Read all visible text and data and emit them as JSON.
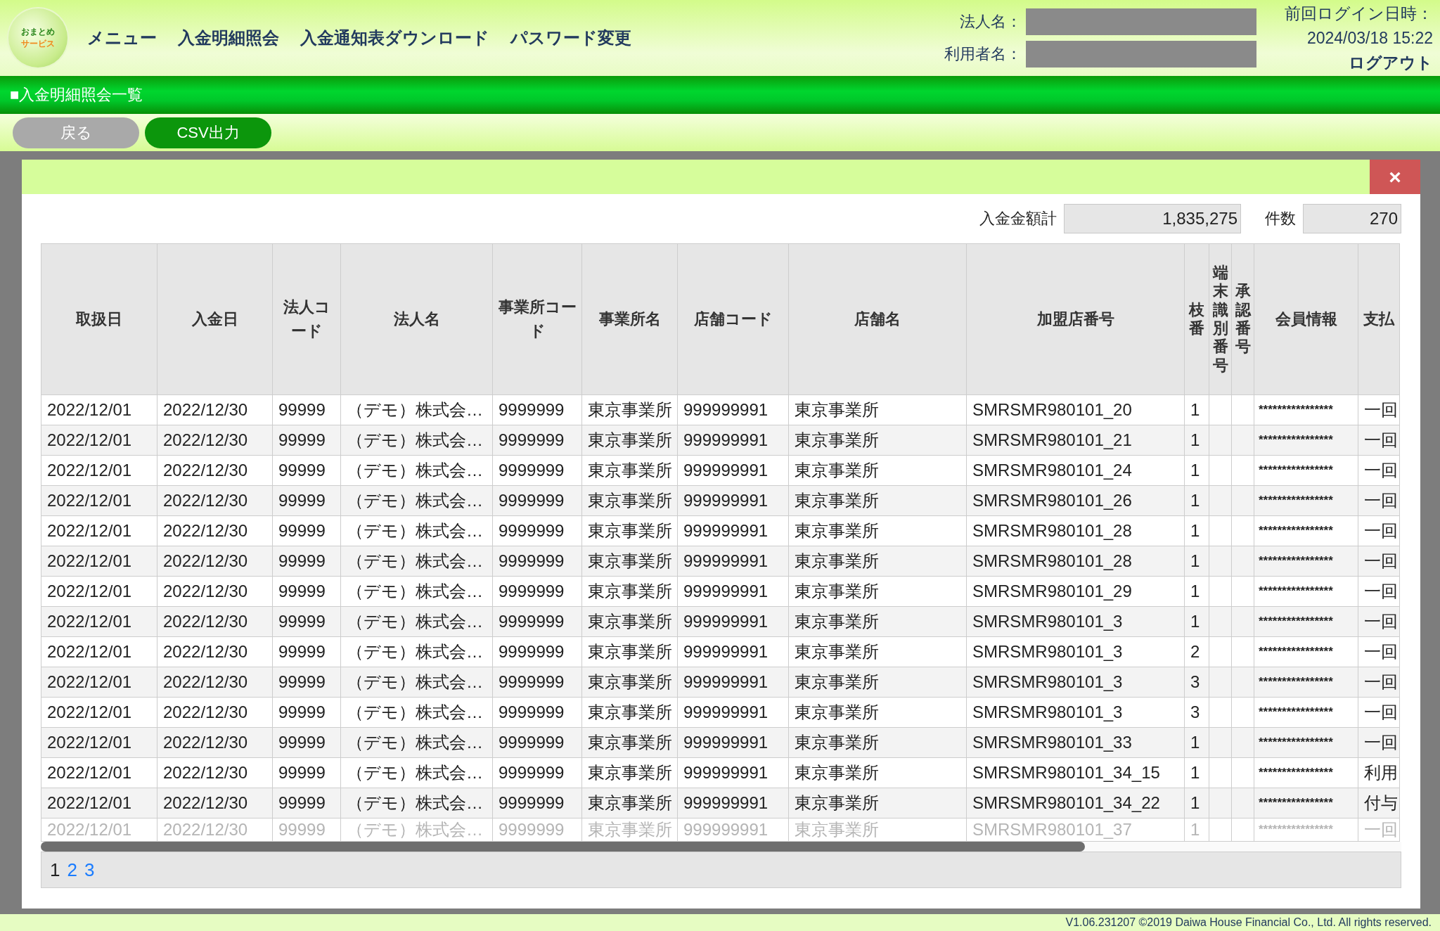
{
  "logo": {
    "line1": "おまとめ",
    "line2": "サービス"
  },
  "nav": [
    "メニュー",
    "入金明細照会",
    "入金通知表ダウンロード",
    "パスワード変更"
  ],
  "user_info": {
    "company_label": "法人名：",
    "user_label": "利用者名：",
    "last_login_label": "前回ログイン日時：",
    "last_login": "2024/03/18 15:22",
    "logout": "ログアウト"
  },
  "page_title": "■入金明細照会一覧",
  "buttons": [
    {
      "label": "戻る",
      "kind": "back"
    },
    {
      "label": "CSV出力",
      "kind": "primary"
    }
  ],
  "modal": {
    "close": "×",
    "totals": [
      {
        "label": "入金金額計",
        "value": "1,835,275",
        "kind": "amount"
      },
      {
        "label": "件数",
        "value": "270",
        "kind": "count"
      }
    ],
    "table": {
      "columns": [
        "取扱日",
        "入金日",
        "法人コード",
        "法人名",
        "事業所コード",
        "事業所名",
        "店舗コード",
        "店舗名",
        "加盟店番号",
        "枝番",
        "端末識別番号",
        "承認番号",
        "会員情報",
        "支払"
      ],
      "rows": [
        {
          "date": "2022/12/01",
          "paid": "2022/12/30",
          "corp_code": "99999",
          "corp": "（デモ）株式会…",
          "office_code": "9999999",
          "office": "東京事業所",
          "store_code": "999999991",
          "store": "東京事業所",
          "merchant": "SMRSMR980101_20",
          "branch": "1",
          "member": "****************",
          "pay": "一回"
        },
        {
          "date": "2022/12/01",
          "paid": "2022/12/30",
          "corp_code": "99999",
          "corp": "（デモ）株式会…",
          "office_code": "9999999",
          "office": "東京事業所",
          "store_code": "999999991",
          "store": "東京事業所",
          "merchant": "SMRSMR980101_21",
          "branch": "1",
          "member": "****************",
          "pay": "一回"
        },
        {
          "date": "2022/12/01",
          "paid": "2022/12/30",
          "corp_code": "99999",
          "corp": "（デモ）株式会…",
          "office_code": "9999999",
          "office": "東京事業所",
          "store_code": "999999991",
          "store": "東京事業所",
          "merchant": "SMRSMR980101_24",
          "branch": "1",
          "member": "****************",
          "pay": "一回"
        },
        {
          "date": "2022/12/01",
          "paid": "2022/12/30",
          "corp_code": "99999",
          "corp": "（デモ）株式会…",
          "office_code": "9999999",
          "office": "東京事業所",
          "store_code": "999999991",
          "store": "東京事業所",
          "merchant": "SMRSMR980101_26",
          "branch": "1",
          "member": "****************",
          "pay": "一回"
        },
        {
          "date": "2022/12/01",
          "paid": "2022/12/30",
          "corp_code": "99999",
          "corp": "（デモ）株式会…",
          "office_code": "9999999",
          "office": "東京事業所",
          "store_code": "999999991",
          "store": "東京事業所",
          "merchant": "SMRSMR980101_28",
          "branch": "1",
          "member": "****************",
          "pay": "一回"
        },
        {
          "date": "2022/12/01",
          "paid": "2022/12/30",
          "corp_code": "99999",
          "corp": "（デモ）株式会…",
          "office_code": "9999999",
          "office": "東京事業所",
          "store_code": "999999991",
          "store": "東京事業所",
          "merchant": "SMRSMR980101_28",
          "branch": "1",
          "member": "****************",
          "pay": "一回"
        },
        {
          "date": "2022/12/01",
          "paid": "2022/12/30",
          "corp_code": "99999",
          "corp": "（デモ）株式会…",
          "office_code": "9999999",
          "office": "東京事業所",
          "store_code": "999999991",
          "store": "東京事業所",
          "merchant": "SMRSMR980101_29",
          "branch": "1",
          "member": "****************",
          "pay": "一回"
        },
        {
          "date": "2022/12/01",
          "paid": "2022/12/30",
          "corp_code": "99999",
          "corp": "（デモ）株式会…",
          "office_code": "9999999",
          "office": "東京事業所",
          "store_code": "999999991",
          "store": "東京事業所",
          "merchant": "SMRSMR980101_3",
          "branch": "1",
          "member": "****************",
          "pay": "一回"
        },
        {
          "date": "2022/12/01",
          "paid": "2022/12/30",
          "corp_code": "99999",
          "corp": "（デモ）株式会…",
          "office_code": "9999999",
          "office": "東京事業所",
          "store_code": "999999991",
          "store": "東京事業所",
          "merchant": "SMRSMR980101_3",
          "branch": "2",
          "member": "****************",
          "pay": "一回"
        },
        {
          "date": "2022/12/01",
          "paid": "2022/12/30",
          "corp_code": "99999",
          "corp": "（デモ）株式会…",
          "office_code": "9999999",
          "office": "東京事業所",
          "store_code": "999999991",
          "store": "東京事業所",
          "merchant": "SMRSMR980101_3",
          "branch": "3",
          "member": "****************",
          "pay": "一回"
        },
        {
          "date": "2022/12/01",
          "paid": "2022/12/30",
          "corp_code": "99999",
          "corp": "（デモ）株式会…",
          "office_code": "9999999",
          "office": "東京事業所",
          "store_code": "999999991",
          "store": "東京事業所",
          "merchant": "SMRSMR980101_3",
          "branch": "3",
          "member": "****************",
          "pay": "一回"
        },
        {
          "date": "2022/12/01",
          "paid": "2022/12/30",
          "corp_code": "99999",
          "corp": "（デモ）株式会…",
          "office_code": "9999999",
          "office": "東京事業所",
          "store_code": "999999991",
          "store": "東京事業所",
          "merchant": "SMRSMR980101_33",
          "branch": "1",
          "member": "****************",
          "pay": "一回"
        },
        {
          "date": "2022/12/01",
          "paid": "2022/12/30",
          "corp_code": "99999",
          "corp": "（デモ）株式会…",
          "office_code": "9999999",
          "office": "東京事業所",
          "store_code": "999999991",
          "store": "東京事業所",
          "merchant": "SMRSMR980101_34_15",
          "branch": "1",
          "member": "****************",
          "pay": "利用"
        },
        {
          "date": "2022/12/01",
          "paid": "2022/12/30",
          "corp_code": "99999",
          "corp": "（デモ）株式会…",
          "office_code": "9999999",
          "office": "東京事業所",
          "store_code": "999999991",
          "store": "東京事業所",
          "merchant": "SMRSMR980101_34_22",
          "branch": "1",
          "member": "****************",
          "pay": "付与"
        }
      ],
      "partial_row": {
        "date": "2022/12/01",
        "paid": "2022/12/30",
        "corp_code": "99999",
        "corp": "（デモ）株式会…",
        "office_code": "9999999",
        "office": "東京事業所",
        "store_code": "999999991",
        "store": "東京事業所",
        "merchant": "SMRSMR980101_37",
        "branch": "1",
        "member": "****************",
        "pay": "一回"
      }
    },
    "pages": [
      {
        "label": "1",
        "selected": true
      },
      {
        "label": "2",
        "selected": false
      },
      {
        "label": "3",
        "selected": false
      }
    ]
  },
  "footer": "V1.06.231207 ©2019 Daiwa House Financial Co., Ltd. All rights reserved."
}
